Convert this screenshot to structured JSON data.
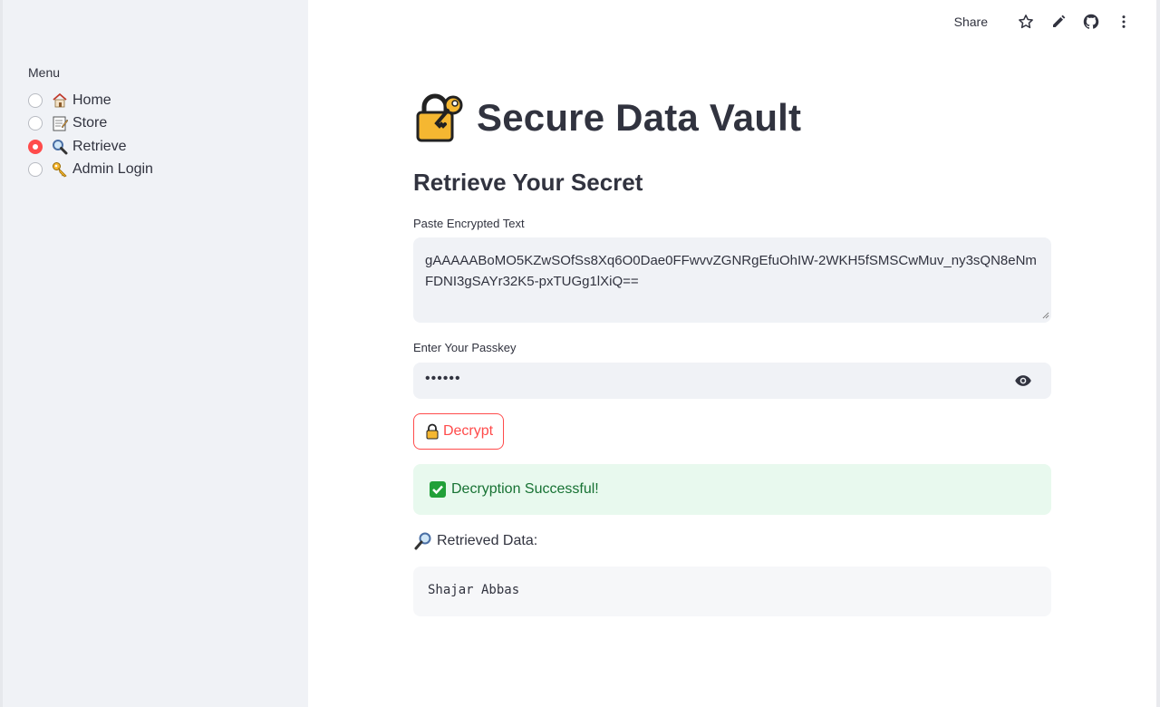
{
  "sidebar": {
    "menu_label": "Menu",
    "items": [
      {
        "label": "Home",
        "icon": "house-icon",
        "selected": false
      },
      {
        "label": "Store",
        "icon": "memo-icon",
        "selected": false
      },
      {
        "label": "Retrieve",
        "icon": "magnifier-icon",
        "selected": true
      },
      {
        "label": "Admin Login",
        "icon": "key-icon",
        "selected": false
      }
    ]
  },
  "toolbar": {
    "share_label": "Share",
    "icons": [
      "star-icon",
      "edit-icon",
      "github-icon",
      "more-icon"
    ]
  },
  "main": {
    "title": "Secure Data Vault",
    "title_icon": "lock-with-key-icon",
    "subheader": "Retrieve Your Secret",
    "encrypted_label": "Paste Encrypted Text",
    "encrypted_value": "gAAAAABoMO5KZwSOfSs8Xq6O0Dae0FFwvvZGNRgEfuOhIW-2WKH5fSMSCwMuv_ny3sQN8eNmFDNI3gSAYr32K5-pxTUGg1lXiQ==",
    "passkey_label": "Enter Your Passkey",
    "passkey_value": "••••••",
    "decrypt_label": "Decrypt",
    "success_text": "Decryption Successful!",
    "retrieved_label": "Retrieved Data:",
    "retrieved_value": "Shajar Abbas"
  },
  "colors": {
    "accent": "#ff4b4b",
    "sidebar_bg": "#f0f2f6",
    "success_bg": "#e8f9ee",
    "success_text": "#177233"
  }
}
